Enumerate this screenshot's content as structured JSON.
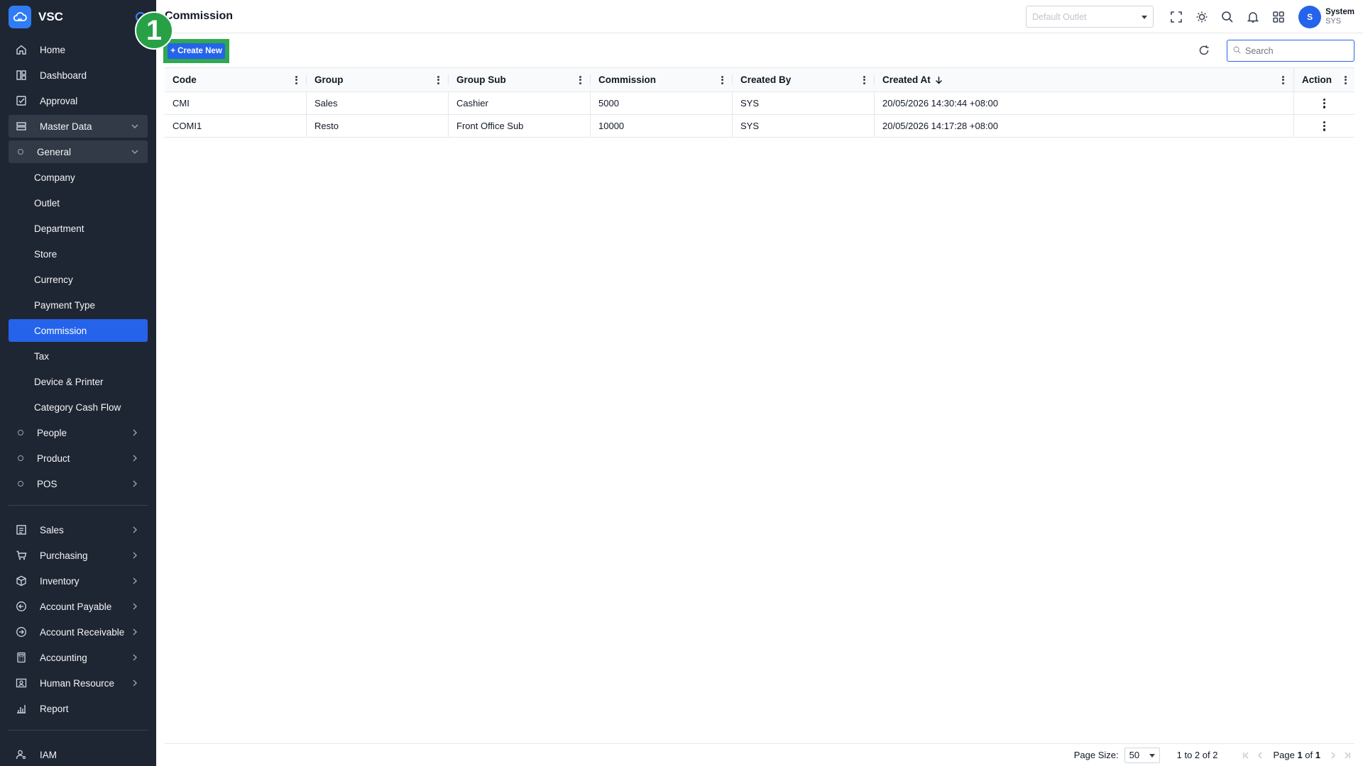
{
  "app": {
    "name": "VSC"
  },
  "sidebar": {
    "items": [
      {
        "label": "Home",
        "icon": "home-icon"
      },
      {
        "label": "Dashboard",
        "icon": "dashboard-icon"
      },
      {
        "label": "Approval",
        "icon": "approval-icon"
      },
      {
        "label": "Master Data",
        "icon": "master-data-icon",
        "expanded": true
      },
      {
        "label": "General",
        "expanded": true
      },
      {
        "label": "Company"
      },
      {
        "label": "Outlet"
      },
      {
        "label": "Department"
      },
      {
        "label": "Store"
      },
      {
        "label": "Currency"
      },
      {
        "label": "Payment Type"
      },
      {
        "label": "Commission",
        "active": true
      },
      {
        "label": "Tax"
      },
      {
        "label": "Device & Printer"
      },
      {
        "label": "Category Cash Flow"
      },
      {
        "label": "People"
      },
      {
        "label": "Product"
      },
      {
        "label": "POS"
      },
      {
        "label": "Sales",
        "icon": "sales-icon"
      },
      {
        "label": "Purchasing",
        "icon": "cart-icon"
      },
      {
        "label": "Inventory",
        "icon": "box-icon"
      },
      {
        "label": "Account Payable",
        "icon": "arrow-left-circle-icon"
      },
      {
        "label": "Account Receivable",
        "icon": "arrow-right-circle-icon"
      },
      {
        "label": "Accounting",
        "icon": "calculator-icon"
      },
      {
        "label": "Human Resource",
        "icon": "id-card-icon"
      },
      {
        "label": "Report",
        "icon": "bar-chart-icon"
      },
      {
        "label": "IAM",
        "icon": "user-key-icon"
      }
    ]
  },
  "header": {
    "title": "Commission",
    "outlet_placeholder": "Default Outlet",
    "user_name": "System",
    "user_code": "SYS",
    "avatar_initial": "S"
  },
  "annotation": {
    "step": "1",
    "color": "#27a046"
  },
  "toolbar": {
    "create_label": "+ Create New",
    "search_placeholder": "Search"
  },
  "table": {
    "columns": [
      "Code",
      "Group",
      "Group Sub",
      "Commission",
      "Created By",
      "Created At",
      "Action"
    ],
    "rows": [
      [
        "CMI",
        "Sales",
        "Cashier",
        "5000",
        "SYS",
        "20/05/2026 14:30:44 +08:00"
      ],
      [
        "COMI1",
        "Resto",
        "Front Office Sub",
        "10000",
        "SYS",
        "20/05/2026 14:17:28 +08:00"
      ]
    ]
  },
  "footer": {
    "page_size_label": "Page Size:",
    "page_size_value": "50",
    "range_text": "1 to 2 of 2",
    "page_prefix": "Page ",
    "page_current": "1",
    "page_of": " of ",
    "page_total": "1"
  },
  "colors": {
    "accent": "#2563eb",
    "sidebar_bg": "#1f2633",
    "highlight": "#2fa84f"
  }
}
